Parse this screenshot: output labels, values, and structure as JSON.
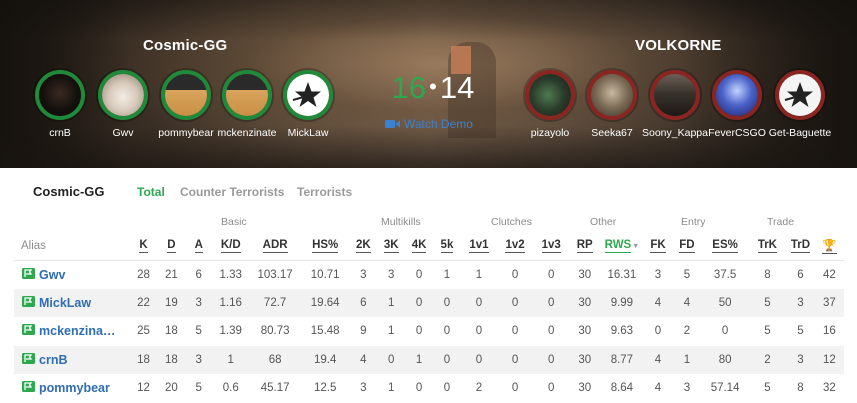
{
  "match": {
    "left_team": {
      "name": "Cosmic-GG",
      "players": [
        {
          "name": "crnB",
          "avatar_icon": "dark-photo-avatar"
        },
        {
          "name": "Gwv",
          "avatar_icon": "hamster-avatar"
        },
        {
          "name": "pommybear",
          "avatar_icon": "dog-with-cap-avatar"
        },
        {
          "name": "mckenzinate",
          "avatar_icon": "dog-with-cap-avatar"
        },
        {
          "name": "MickLaw",
          "avatar_icon": "star-logo-avatar"
        }
      ]
    },
    "right_team": {
      "name": "VOLKORNE",
      "players": [
        {
          "name": "pizayolo",
          "avatar_icon": "painted-face-avatar"
        },
        {
          "name": "Seeka67",
          "avatar_icon": "person-photo-avatar"
        },
        {
          "name": "Soony_Kappa",
          "avatar_icon": "im-black-get-rekt-avatar"
        },
        {
          "name": "FeverCSGO",
          "avatar_icon": "anime-character-avatar"
        },
        {
          "name": "Get-Baguette",
          "avatar_icon": "star-logo-avatar"
        }
      ]
    },
    "score_left": "16",
    "score_separator": "•",
    "score_right": "14",
    "watch_demo_label": "Watch Demo",
    "watch_icon": "video-camera-icon"
  },
  "stats": {
    "team_name": "Cosmic-GG",
    "tabs": [
      "Total",
      "Counter Terrorists",
      "Terrorists"
    ],
    "active_tab": "Total",
    "groups": [
      "Basic",
      "Multikills",
      "Clutches",
      "Other",
      "Entry",
      "Trade"
    ],
    "alias_header": "Alias",
    "columns": [
      "K",
      "D",
      "A",
      "K/D",
      "ADR",
      "HS%",
      "2K",
      "3K",
      "4K",
      "5k",
      "1v1",
      "1v2",
      "1v3",
      "RP",
      "RWS",
      "FK",
      "FD",
      "ES%",
      "TrK",
      "TrD",
      "🏆"
    ],
    "sorted_column": "RWS",
    "rows": [
      {
        "name": "Gwv",
        "values": [
          "28",
          "21",
          "6",
          "1.33",
          "103.17",
          "10.71",
          "3",
          "3",
          "0",
          "1",
          "1",
          "0",
          "0",
          "30",
          "16.31",
          "3",
          "5",
          "37.5",
          "8",
          "6",
          "42"
        ]
      },
      {
        "name": "MickLaw",
        "values": [
          "22",
          "19",
          "3",
          "1.16",
          "72.7",
          "19.64",
          "6",
          "1",
          "0",
          "0",
          "0",
          "0",
          "0",
          "30",
          "9.99",
          "4",
          "4",
          "50",
          "5",
          "3",
          "37"
        ]
      },
      {
        "name": "mckenzina…",
        "values": [
          "25",
          "18",
          "5",
          "1.39",
          "80.73",
          "15.48",
          "9",
          "1",
          "0",
          "0",
          "0",
          "0",
          "0",
          "30",
          "9.63",
          "0",
          "2",
          "0",
          "5",
          "5",
          "16"
        ]
      },
      {
        "name": "crnB",
        "values": [
          "18",
          "18",
          "3",
          "1",
          "68",
          "19.4",
          "4",
          "0",
          "1",
          "0",
          "0",
          "0",
          "0",
          "30",
          "8.77",
          "4",
          "1",
          "80",
          "2",
          "3",
          "12"
        ]
      },
      {
        "name": "pommybear",
        "values": [
          "12",
          "20",
          "5",
          "0.6",
          "45.17",
          "12.5",
          "3",
          "1",
          "0",
          "0",
          "2",
          "0",
          "0",
          "30",
          "8.64",
          "4",
          "3",
          "57.14",
          "5",
          "8",
          "32"
        ]
      }
    ],
    "row_flag_icon": "flag-icon",
    "accent_color": "#2ea84f",
    "link_color": "#2f6db4"
  }
}
